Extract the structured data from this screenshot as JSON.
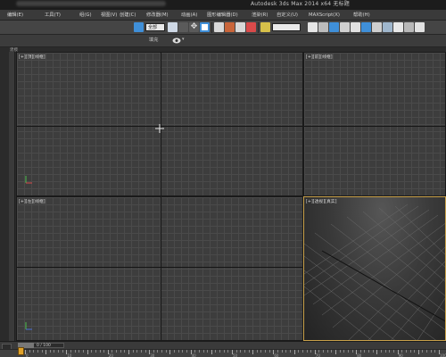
{
  "window": {
    "title": "Autodesk 3ds Max 2014 x64    无标题"
  },
  "menu": {
    "items": [
      {
        "label": "编辑(E)"
      },
      {
        "label": "工具(T)"
      },
      {
        "label": "组(G)"
      },
      {
        "label": "视图(V)"
      },
      {
        "label": "创建(C)"
      },
      {
        "label": "修改器(M)"
      },
      {
        "label": "动画(A)"
      },
      {
        "label": "图形编辑器(D)"
      },
      {
        "label": "渲染(R)"
      },
      {
        "label": "自定义(U)"
      },
      {
        "label": "MAXScript(X)"
      },
      {
        "label": "帮助(H)"
      }
    ]
  },
  "toolbar": {
    "filter_value": "全部",
    "selection_set_value": "",
    "accent_color": "#3f8fd8"
  },
  "ribbon": {
    "label": "填充",
    "caret": "▾"
  },
  "side_label": "建模",
  "viewports": {
    "top_label": "[+][顶][线框]",
    "front_label": "[+][前][线框]",
    "left_label": "[+][左][线框]",
    "persp_label": "[+][透视][真实]"
  },
  "timeline": {
    "frame": "0 / 100",
    "ticks": [
      "0",
      "5",
      "10",
      "15",
      "20",
      "25",
      "30",
      "35",
      "40",
      "45",
      "50",
      "55",
      "60",
      "65",
      "70",
      "75",
      "80",
      "85",
      "90",
      "95",
      "100"
    ],
    "key_color": "#e0a22a"
  }
}
